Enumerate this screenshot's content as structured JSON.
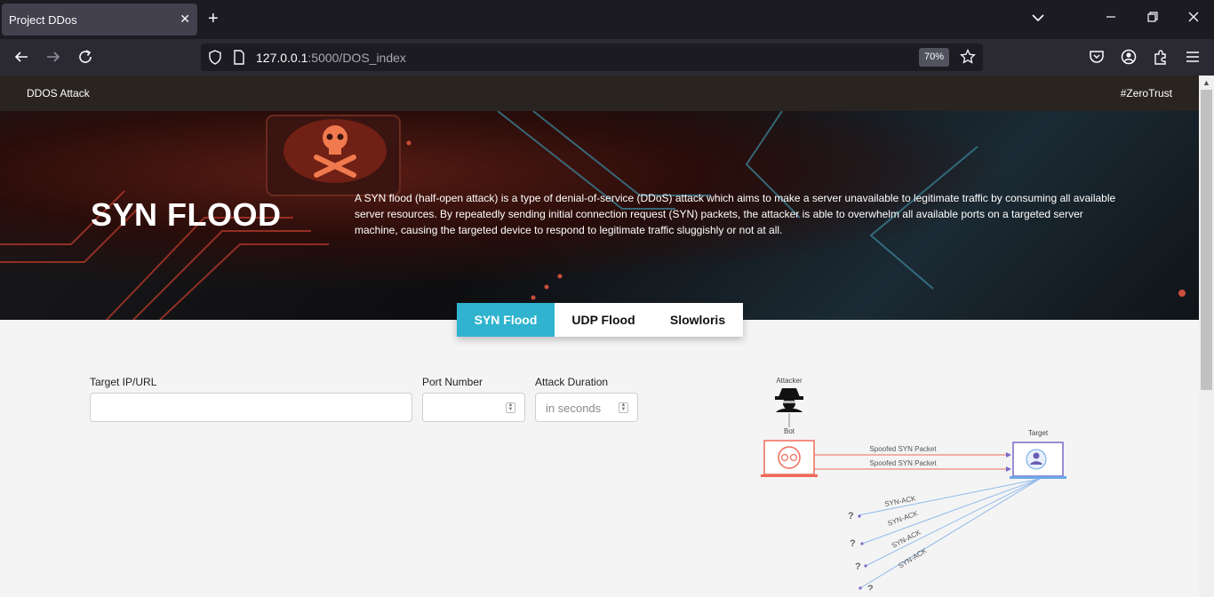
{
  "browser": {
    "tab_title": "Project DDos",
    "url_host": "127.0.0.1",
    "url_rest": ":5000/DOS_index",
    "zoom": "70%"
  },
  "site": {
    "brand": "DDOS Attack",
    "tagline": "#ZeroTrust"
  },
  "hero": {
    "title": "SYN FLOOD",
    "description": "A SYN flood (half-open attack) is a type of denial-of-service (DDoS) attack which aims to make a server unavailable to legitimate traffic by consuming all available server resources. By repeatedly sending initial connection request (SYN) packets, the attacker is able to overwhelm all available ports on a targeted server machine, causing the targeted device to respond to legitimate traffic sluggishly or not at all."
  },
  "attack_tabs": [
    {
      "label": "SYN Flood",
      "active": true
    },
    {
      "label": "UDP Flood",
      "active": false
    },
    {
      "label": "Slowloris",
      "active": false
    }
  ],
  "form": {
    "target_label": "Target IP/URL",
    "target_value": "",
    "port_label": "Port Number",
    "port_value": "",
    "duration_label": "Attack Duration",
    "duration_placeholder": "in seconds"
  },
  "diagram": {
    "attacker": "Attacker",
    "bot": "Bot",
    "target": "Target",
    "packet_1": "Spoofed SYN Packet",
    "packet_2": "Spoofed SYN Packet",
    "ack": "SYN-ACK",
    "unknown": "?"
  },
  "colors": {
    "accent": "#2fb3cf",
    "bot_red": "#ef6c5a",
    "target_blue": "#6aa8e8"
  }
}
